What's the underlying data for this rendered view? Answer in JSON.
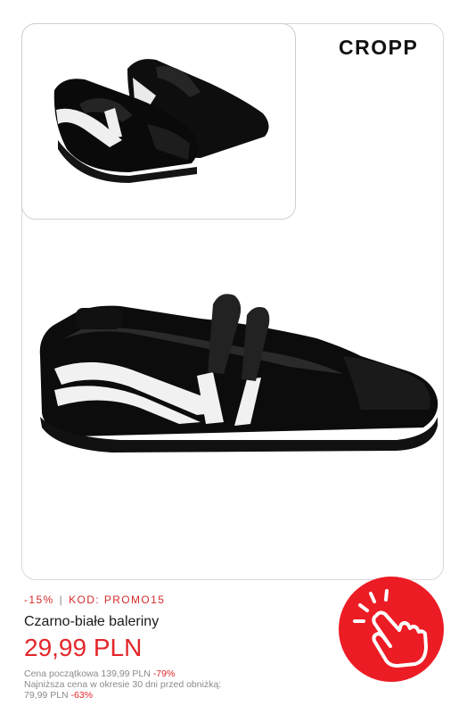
{
  "brand": {
    "logo_text": "CROPP"
  },
  "product": {
    "discount_label": "-15%",
    "code_label": "KOD: PROMO15",
    "name": "Czarno-białe baleriny",
    "price": "29,99 PLN",
    "original_price_text": "Cena początkowa 139,99 PLN",
    "original_discount": "-79%",
    "lowest_price_text_line1": "Najniższa cena w okresie 30 dni przed obniżką:",
    "lowest_price_text_line2": "79,99 PLN",
    "lowest_discount": "-63%"
  },
  "icons": {
    "cta": "tap-hand-icon"
  },
  "colors": {
    "accent": "#e3262b",
    "button": "#ec1c24"
  }
}
